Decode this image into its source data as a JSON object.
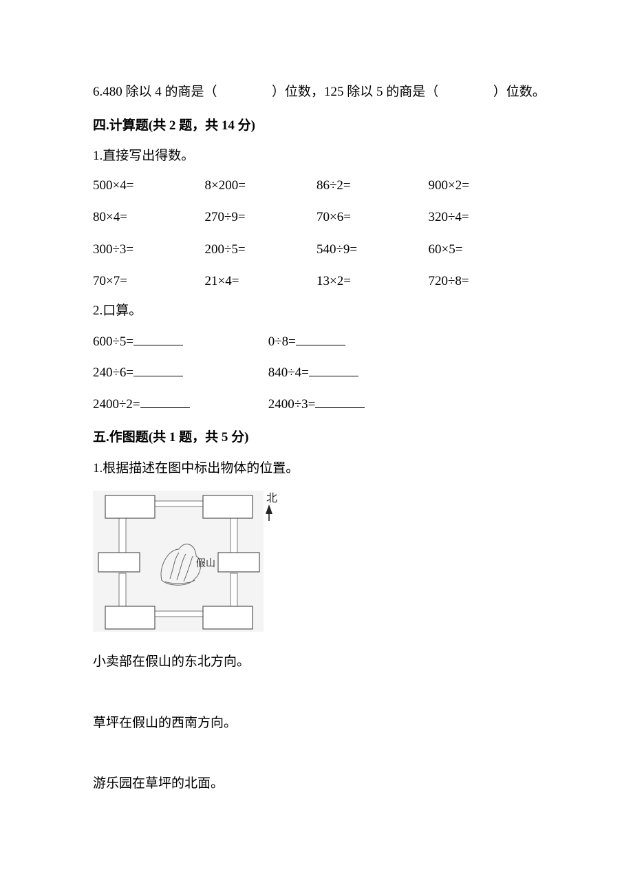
{
  "q6_prefix": "6.480 除以 4 的商是（",
  "q6_mid": "）位数，125 除以 5 的商是（",
  "q6_suffix": "）位数。",
  "sec4_title": "四.计算题(共 2 题，共 14 分)",
  "sec4_q1": "1.直接写出得数。",
  "calc_grid": [
    [
      "500×4=",
      "8×200=",
      "86÷2=",
      "900×2="
    ],
    [
      "80×4=",
      "270÷9=",
      "70×6=",
      "320÷4="
    ],
    [
      "300÷3=",
      "200÷5=",
      "540÷9=",
      " 60×5="
    ],
    [
      "70×7=",
      "21×4=",
      "13×2=",
      "720÷8="
    ]
  ],
  "sec4_q2": "2.口算。",
  "pairs": [
    [
      "600÷5=",
      "0÷8="
    ],
    [
      "240÷6=",
      "840÷4="
    ],
    [
      "2400÷2=",
      "2400÷3="
    ]
  ],
  "sec5_title": "五.作图题(共 1 题，共 5 分)",
  "sec5_q1": "1.根据描述在图中标出物体的位置。",
  "north_label": "北",
  "fig_center_label": "假山",
  "desc1": "小卖部在假山的东北方向。",
  "desc2": "草坪在假山的西南方向。",
  "desc3": "游乐园在草坪的北面。"
}
